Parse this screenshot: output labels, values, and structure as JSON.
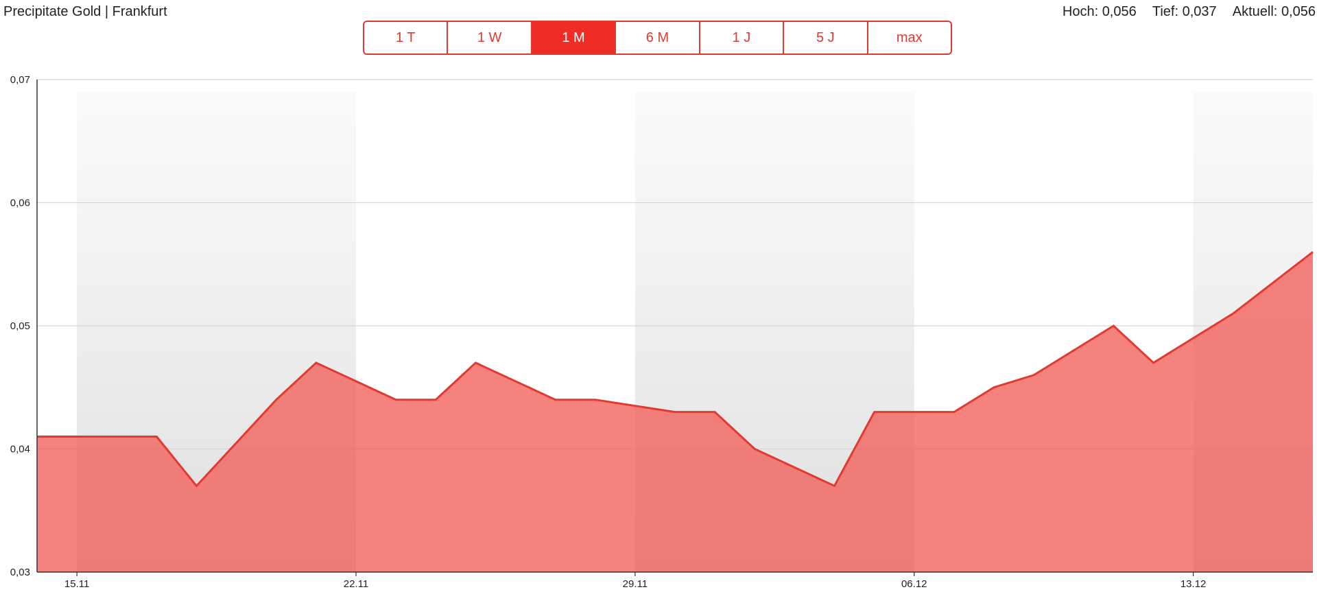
{
  "header": {
    "title": "Precipitate Gold | Frankfurt",
    "stats": [
      {
        "label": "Hoch:",
        "value": "0,056"
      },
      {
        "label": "Tief:",
        "value": "0,037"
      },
      {
        "label": "Aktuell:",
        "value": "0,056"
      }
    ]
  },
  "ranges": [
    {
      "label": "1 T",
      "active": false
    },
    {
      "label": "1 W",
      "active": false
    },
    {
      "label": "1 M",
      "active": true
    },
    {
      "label": "6 M",
      "active": false
    },
    {
      "label": "1 J",
      "active": false
    },
    {
      "label": "5 J",
      "active": false
    },
    {
      "label": "max",
      "active": false
    }
  ],
  "colors": {
    "accent": "#e0392f",
    "active_bg": "#ef2d26",
    "line": "#e03a31",
    "area": "#f25f58"
  },
  "chart_data": {
    "type": "area",
    "title": "",
    "xlabel": "",
    "ylabel": "",
    "xlim": [
      "2023-11-14",
      "2023-12-16"
    ],
    "ylim": [
      0.03,
      0.07
    ],
    "y_ticks": [
      0.03,
      0.04,
      0.05,
      0.06,
      0.07
    ],
    "y_tick_labels": [
      "0,03",
      "0,04",
      "0,05",
      "0,06",
      "0,07"
    ],
    "x_ticks": [
      "2023-11-15",
      "2023-11-22",
      "2023-11-29",
      "2023-12-06",
      "2023-12-13"
    ],
    "x_tick_labels": [
      "15.11",
      "22.11",
      "29.11",
      "06.12",
      "13.12"
    ],
    "grid": "horizontal",
    "shaded_bands": [
      [
        "2023-11-15",
        "2023-11-22"
      ],
      [
        "2023-11-29",
        "2023-12-06"
      ],
      [
        "2023-12-13",
        "2023-12-16"
      ]
    ],
    "series": [
      {
        "x": [
          "2023-11-14",
          "2023-11-17",
          "2023-11-18",
          "2023-11-20",
          "2023-11-21",
          "2023-11-23",
          "2023-11-24",
          "2023-11-25",
          "2023-11-27",
          "2023-11-28",
          "2023-11-30",
          "2023-12-01",
          "2023-12-02",
          "2023-12-04",
          "2023-12-05",
          "2023-12-07",
          "2023-12-08",
          "2023-12-09",
          "2023-12-11",
          "2023-12-12",
          "2023-12-14",
          "2023-12-16"
        ],
        "values": [
          0.041,
          0.041,
          0.037,
          0.044,
          0.047,
          0.044,
          0.044,
          0.047,
          0.044,
          0.044,
          0.043,
          0.043,
          0.04,
          0.037,
          0.043,
          0.043,
          0.045,
          0.046,
          0.05,
          0.047,
          0.051,
          0.056
        ]
      }
    ]
  }
}
